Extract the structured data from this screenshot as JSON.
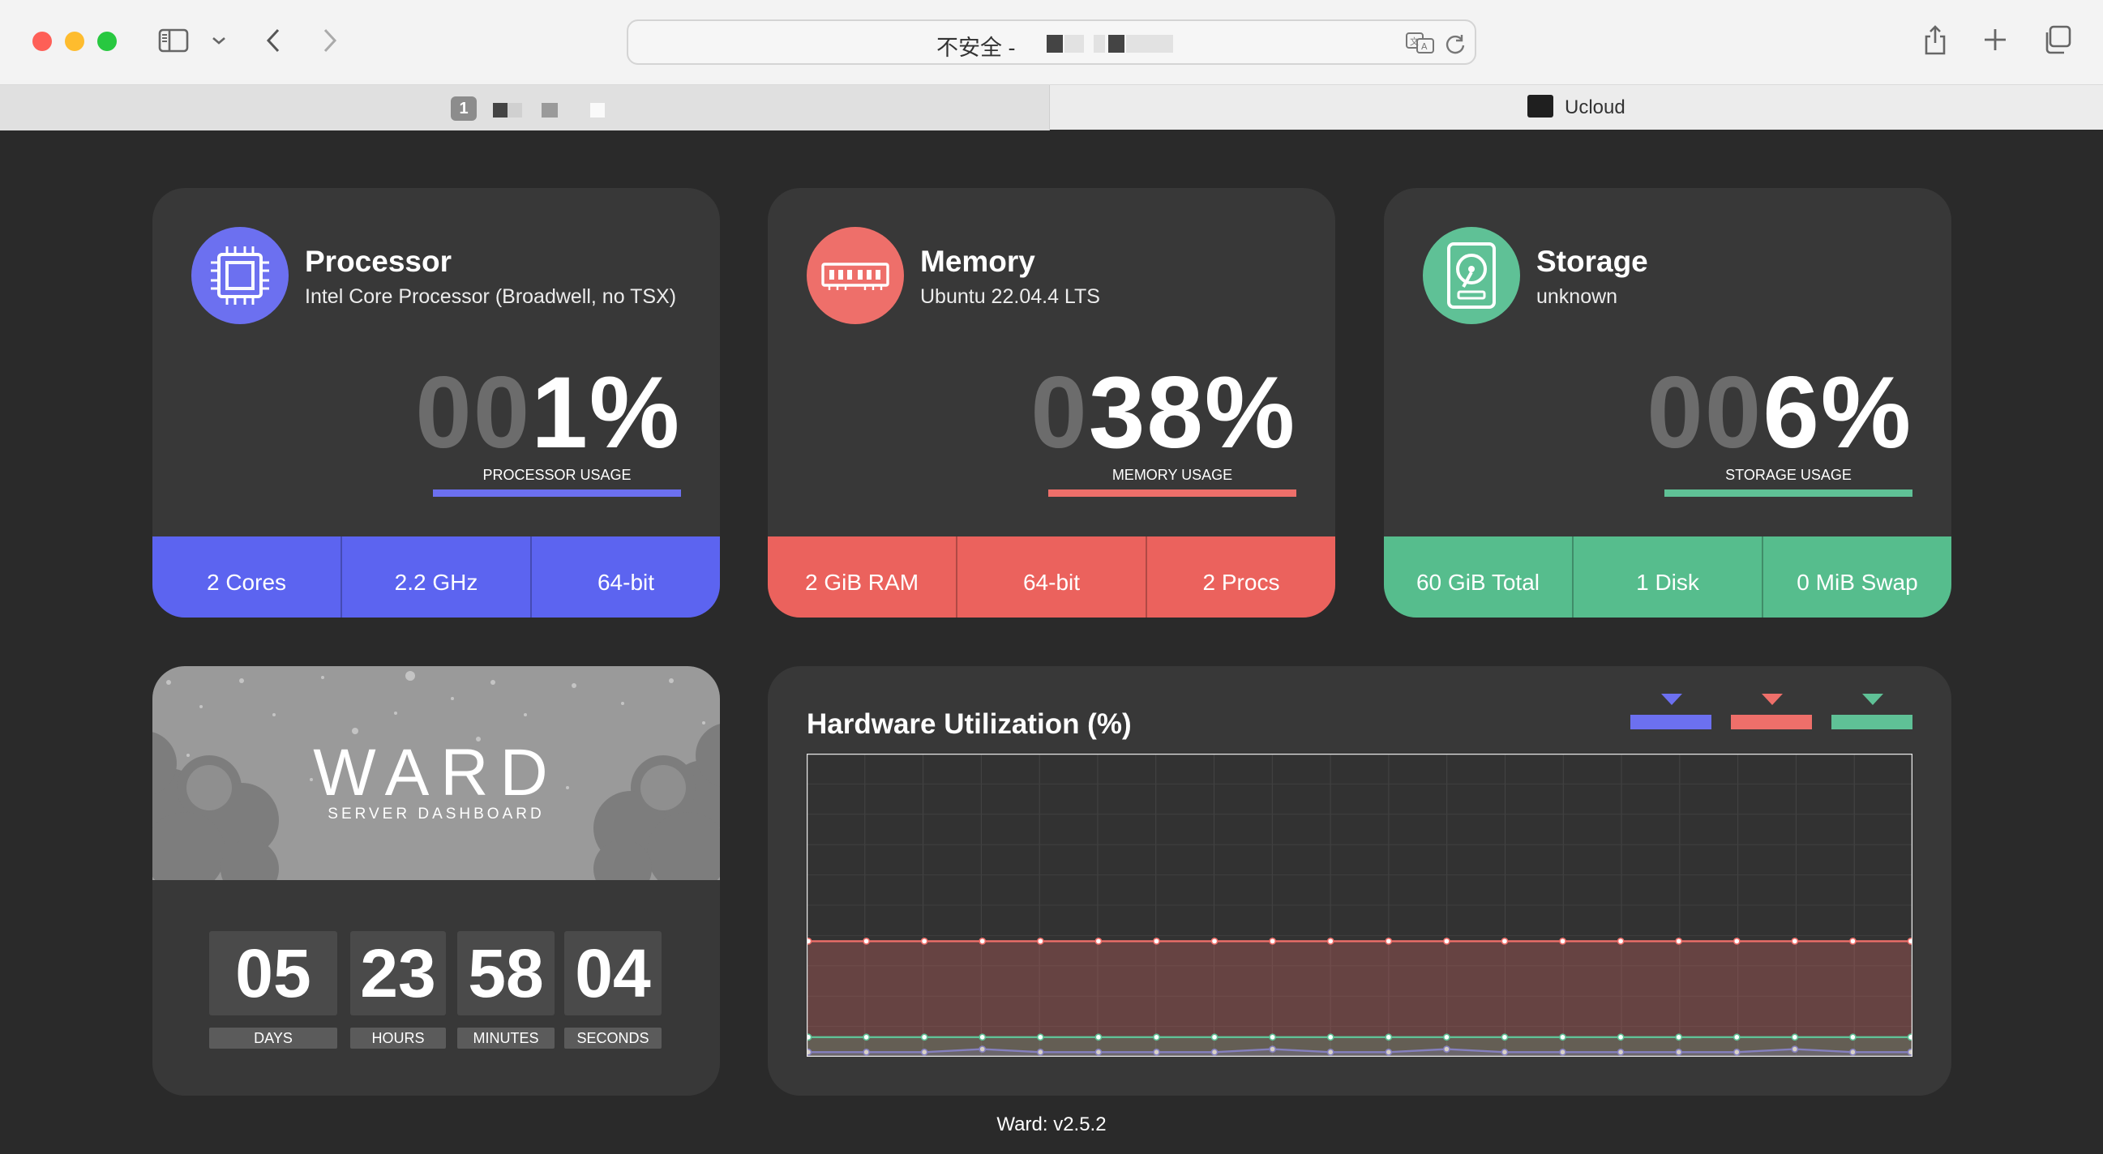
{
  "browser": {
    "address_security": "不安全 -",
    "tab1_badge": "1",
    "tab2_title": "Ucloud"
  },
  "cards": {
    "processor": {
      "title": "Processor",
      "subtitle": "Intel Core Processor (Broadwell, no TSX)",
      "usage_dim": "00",
      "usage_value": "1%",
      "usage_label": "PROCESSOR USAGE",
      "color": "#6c70f0",
      "footer_color": "#5c64f0",
      "footer": [
        "2 Cores",
        "2.2 GHz",
        "64-bit"
      ]
    },
    "memory": {
      "title": "Memory",
      "subtitle": "Ubuntu 22.04.4 LTS",
      "usage_dim": "0",
      "usage_value": "38%",
      "usage_label": "MEMORY USAGE",
      "color": "#ee6f6a",
      "footer_color": "#eb625d",
      "footer": [
        "2 GiB RAM",
        "64-bit",
        "2 Procs"
      ]
    },
    "storage": {
      "title": "Storage",
      "subtitle": "unknown",
      "usage_dim": "00",
      "usage_value": "6%",
      "usage_label": "STORAGE USAGE",
      "color": "#5fc196",
      "footer_color": "#56bd8d",
      "footer": [
        "60 GiB Total",
        "1 Disk",
        "0 MiB Swap"
      ]
    }
  },
  "uptime": {
    "banner_title": "WARD",
    "banner_subtitle": "SERVER DASHBOARD",
    "days": "05",
    "hours": "23",
    "minutes": "58",
    "seconds": "04",
    "labels": [
      "DAYS",
      "HOURS",
      "MINUTES",
      "SECONDS"
    ]
  },
  "chart_data": {
    "type": "line",
    "title": "Hardware Utilization (%)",
    "ylim": [
      0,
      100
    ],
    "x": [
      1,
      2,
      3,
      4,
      5,
      6,
      7,
      8,
      9,
      10,
      11,
      12,
      13,
      14,
      15,
      16,
      17,
      18,
      19,
      20
    ],
    "series": [
      {
        "color": "#6c70f0",
        "values": [
          1,
          1,
          1,
          2,
          1,
          1,
          1,
          1,
          2,
          1,
          1,
          2,
          1,
          1,
          1,
          1,
          1,
          2,
          1,
          1
        ]
      },
      {
        "color": "#ee6f6a",
        "values": [
          38,
          38,
          38,
          38,
          38,
          38,
          38,
          38,
          38,
          38,
          38,
          38,
          38,
          38,
          38,
          38,
          38,
          38,
          38,
          38
        ]
      },
      {
        "color": "#5fc196",
        "values": [
          6,
          6,
          6,
          6,
          6,
          6,
          6,
          6,
          6,
          6,
          6,
          6,
          6,
          6,
          6,
          6,
          6,
          6,
          6,
          6
        ]
      }
    ],
    "grid": true,
    "legend": "top-right"
  },
  "footer": {
    "version": "Ward: v2.5.2"
  }
}
